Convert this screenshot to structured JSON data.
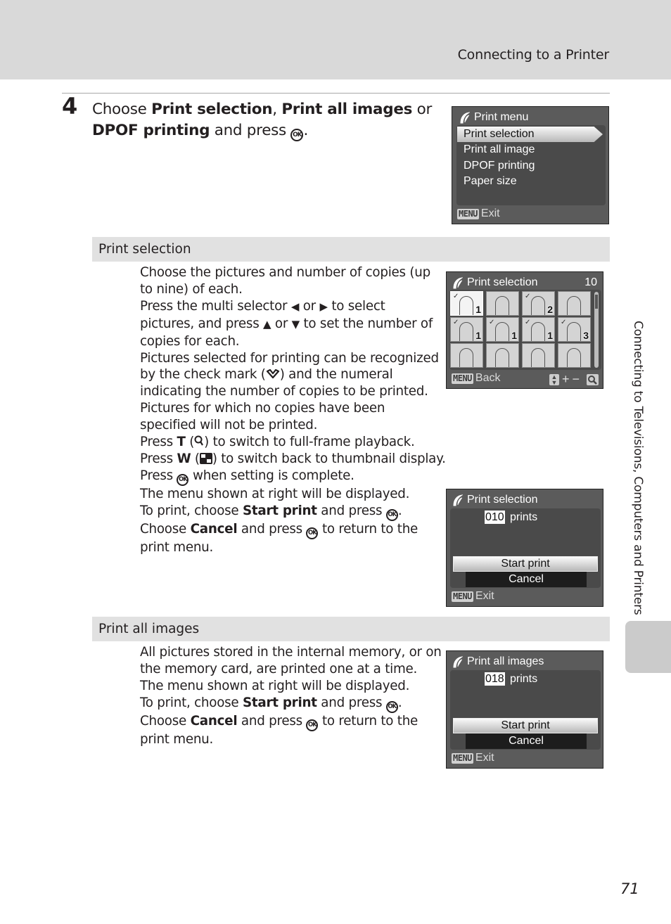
{
  "header": {
    "title": "Connecting to a Printer"
  },
  "step": {
    "number": "4",
    "parts": {
      "choose": "Choose ",
      "opt1": "Print selection",
      "comma": ", ",
      "opt2": "Print all images",
      "or": " or",
      "opt3": "DPOF printing",
      "and_press": " and press ",
      "ok": "OK",
      "period": "."
    }
  },
  "print_menu_screen": {
    "title": "Print menu",
    "items": [
      "Print selection",
      "Print all image",
      "DPOF printing",
      "Paper size"
    ],
    "selected_index": 0,
    "footer_badge": "MENU",
    "footer_label": "Exit"
  },
  "print_selection_section": {
    "heading": "Print selection",
    "lines": {
      "l1": "Choose the pictures and number of copies (up",
      "l2": "to nine) of each.",
      "l3a": "Press the multi selector ",
      "l3b": " or ",
      "l3c": " to select",
      "l4a": "pictures, and press ",
      "l4b": " or ",
      "l4c": " to set the number of",
      "l5": "copies for each.",
      "l6": "Pictures selected for printing can be recognized",
      "l7a": "by the check mark (",
      "l7b": ") and the numeral",
      "l8": "indicating the number of copies to be printed.",
      "l9": "Pictures for which no copies have been",
      "l10": "specified will not be printed.",
      "l11a": "Press ",
      "l11t": "T",
      "l11b": " (",
      "l11c": ") to switch to full-frame playback.",
      "l12a": "Press ",
      "l12w": "W",
      "l12b": " (",
      "l12c": ") to switch back to thumbnail display.",
      "l13a": "Press ",
      "l13b": " when setting is complete.",
      "l14": "The menu shown at right will be displayed.",
      "l15a": "To print, choose ",
      "l15b": "Start print",
      "l15c": " and press ",
      "l15d": ".",
      "l16a": "Choose ",
      "l16b": "Cancel",
      "l16c": " and press ",
      "l16d": " to return to the",
      "l17": "print menu."
    },
    "thumb_screen": {
      "title": "Print selection",
      "count": "10",
      "thumbnails": [
        {
          "checked": true,
          "copies": "1"
        },
        {
          "checked": false,
          "copies": ""
        },
        {
          "checked": true,
          "copies": "2"
        },
        {
          "checked": false,
          "copies": ""
        },
        {
          "checked": true,
          "copies": "1"
        },
        {
          "checked": true,
          "copies": "1"
        },
        {
          "checked": true,
          "copies": "1"
        },
        {
          "checked": true,
          "copies": "3"
        },
        {
          "checked": false,
          "copies": ""
        },
        {
          "checked": false,
          "copies": ""
        },
        {
          "checked": false,
          "copies": ""
        },
        {
          "checked": false,
          "copies": ""
        }
      ],
      "footer_badge": "MENU",
      "footer_label": "Back",
      "plus": "+",
      "minus": "−"
    },
    "confirm_screen": {
      "title": "Print selection",
      "copies": "010",
      "copies_label": "prints",
      "start_label": "Start print",
      "cancel_label": "Cancel",
      "footer_badge": "MENU",
      "footer_label": "Exit"
    }
  },
  "print_all_section": {
    "heading": "Print all images",
    "lines": {
      "l1": "All pictures stored in the internal memory, or on",
      "l2": "the memory card, are printed one at a time.",
      "l3": "The menu shown at right will be displayed.",
      "l4a": "To print, choose ",
      "l4b": "Start print",
      "l4c": " and press ",
      "l4d": ".",
      "l5a": "Choose ",
      "l5b": "Cancel",
      "l5c": " and press ",
      "l5d": " to return to the",
      "l6": "print menu."
    },
    "confirm_screen": {
      "title": "Print all images",
      "copies": "018",
      "copies_label": "prints",
      "start_label": "Start print",
      "cancel_label": "Cancel",
      "footer_badge": "MENU",
      "footer_label": "Exit"
    }
  },
  "side_tab": {
    "label": "Connecting to Televisions, Computers and Printers"
  },
  "page_number": "71"
}
